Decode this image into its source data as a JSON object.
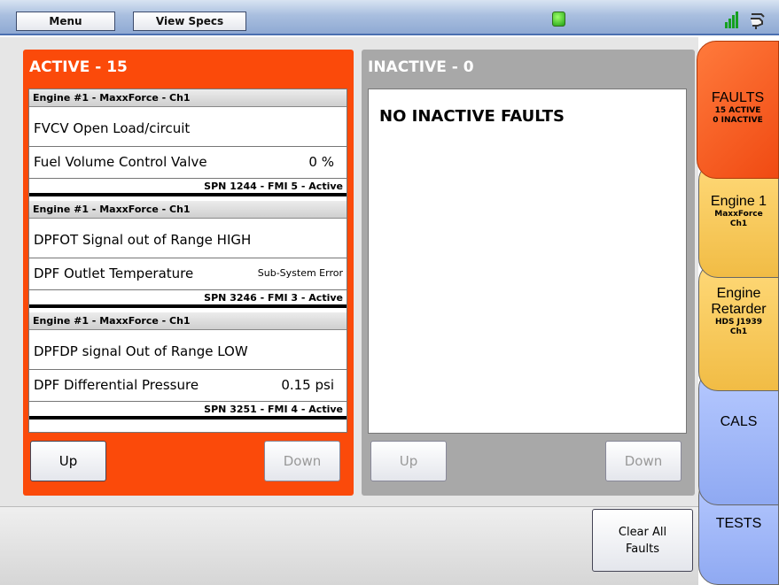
{
  "toolbar": {
    "menu_label": "Menu",
    "specs_label": "View Specs",
    "status_led_color": "#3bd12a"
  },
  "active_panel": {
    "title": "ACTIVE - 15",
    "faults": [
      {
        "source": "Engine #1 - MaxxForce - Ch1",
        "description": "FVCV Open Load/circuit",
        "parameter": "Fuel Volume Control Valve",
        "value": "0 %",
        "code": "SPN 1244 - FMI 5 - Active"
      },
      {
        "source": "Engine #1 - MaxxForce - Ch1",
        "description": "DPFOT Signal out of Range HIGH",
        "parameter": "DPF Outlet Temperature",
        "value": "Sub-System Error",
        "code": "SPN 3246 - FMI 3 - Active"
      },
      {
        "source": "Engine #1 - MaxxForce - Ch1",
        "description": "DPFDP signal Out of Range LOW",
        "parameter": "DPF Differential Pressure",
        "value": "0.15 psi",
        "code": "SPN 3251 - FMI 4 - Active"
      }
    ],
    "up_label": "Up",
    "down_label": "Down"
  },
  "inactive_panel": {
    "title": "INACTIVE - 0",
    "empty_message": "NO INACTIVE FAULTS",
    "up_label": "Up",
    "down_label": "Down"
  },
  "clear_button": {
    "line1": "Clear All",
    "line2": "Faults"
  },
  "tabs": {
    "faults": {
      "label": "FAULTS",
      "sub1": "15 ACTIVE",
      "sub2": "0 INACTIVE"
    },
    "engine1": {
      "label": "Engine 1",
      "sub1": "MaxxForce",
      "sub2": "Ch1"
    },
    "retarder": {
      "label1": "Engine",
      "label2": "Retarder",
      "sub1": "HDS J1939",
      "sub2": "Ch1"
    },
    "cals": {
      "label": "CALS"
    },
    "tests": {
      "label": "TESTS"
    }
  },
  "icons": {
    "signal": "signal-strength-icon",
    "plug": "plug-connection-icon"
  }
}
